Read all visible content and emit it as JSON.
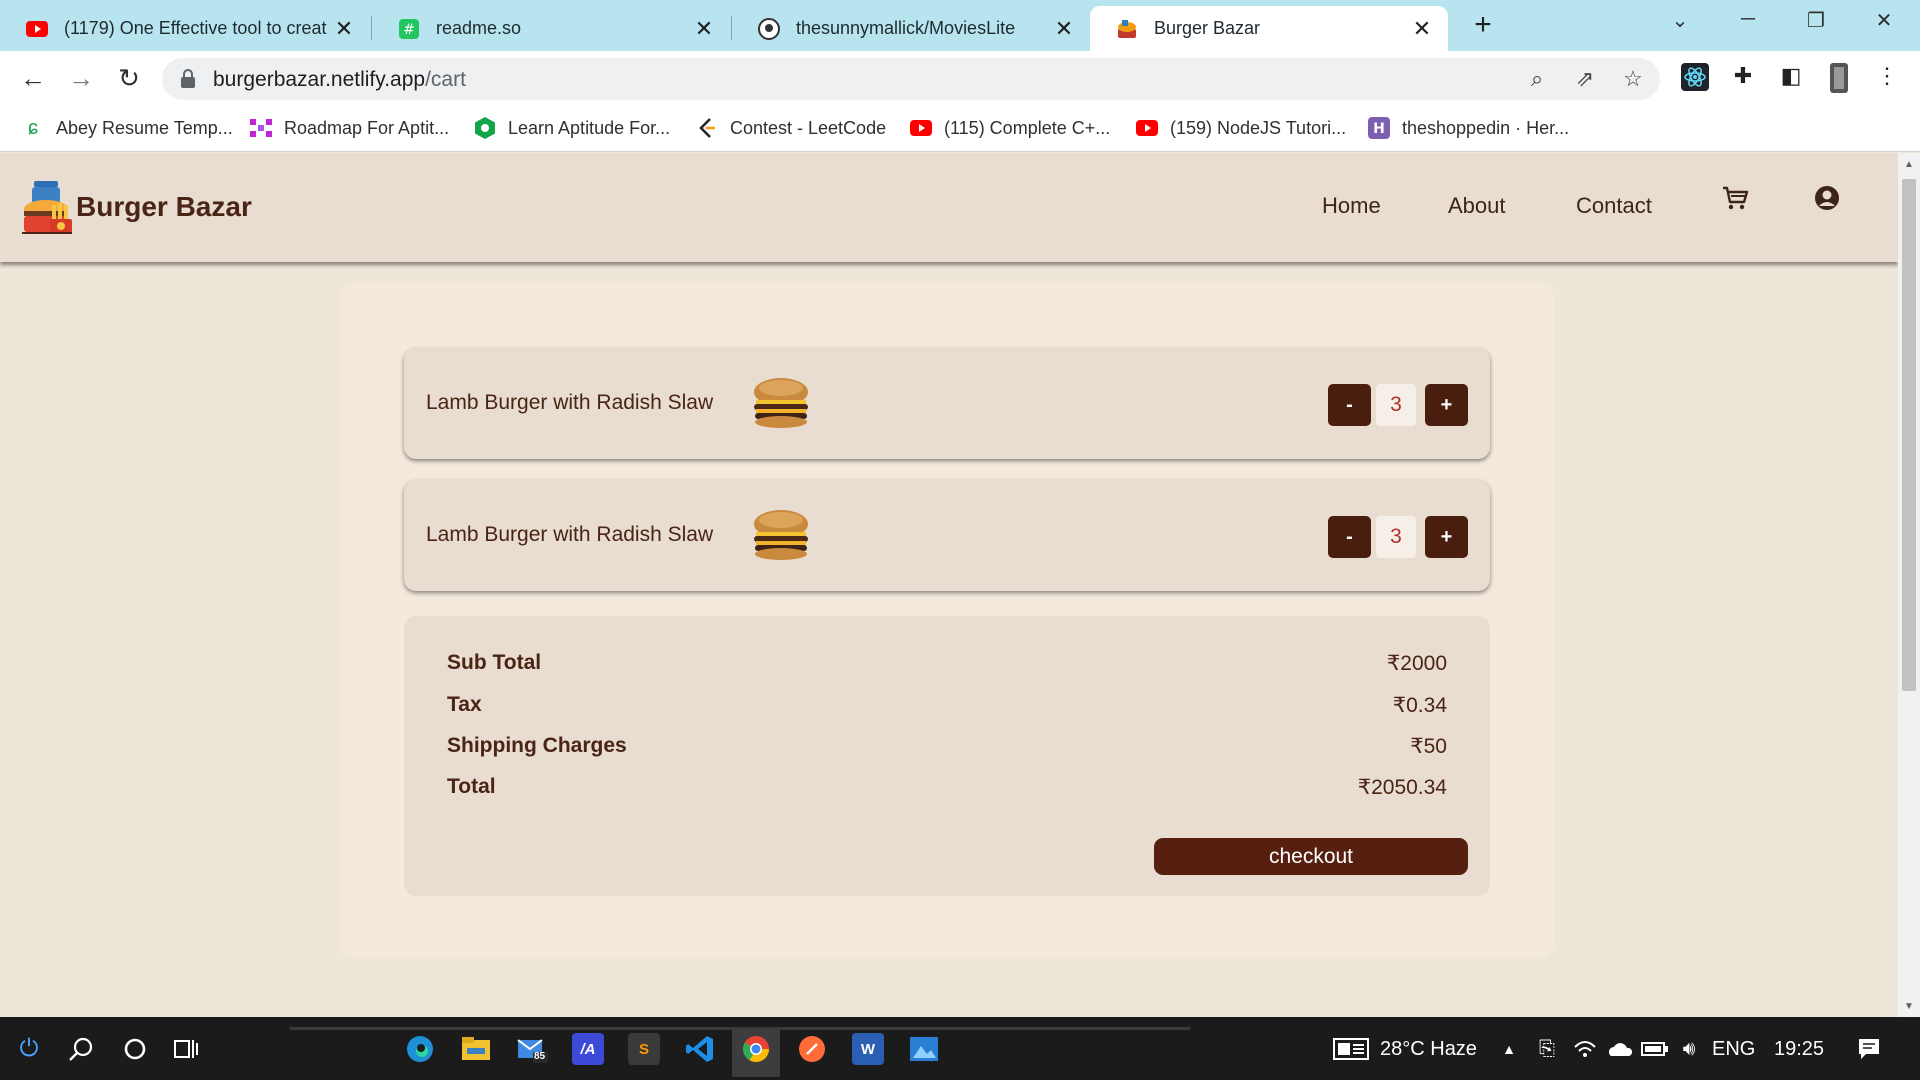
{
  "browser": {
    "tabs": [
      {
        "title": "(1179) One Effective tool to creat",
        "icon": "youtube-icon",
        "active": false
      },
      {
        "title": "readme.so",
        "icon": "readme-icon",
        "active": false
      },
      {
        "title": "thesunnymallick/MoviesLite",
        "icon": "github-icon",
        "active": false
      },
      {
        "title": "Burger Bazar",
        "icon": "burger-bazar-icon",
        "active": true
      }
    ],
    "tab_close_glyph": "✕",
    "new_tab_glyph": "+",
    "url_host": "burgerbazar.netlify.app",
    "url_path": "/cart",
    "bookmarks": [
      {
        "label": "Abey Resume Temp...",
        "icon": "leaf-icon"
      },
      {
        "label": "Roadmap For Aptit...",
        "icon": "roadmap-icon"
      },
      {
        "label": "Learn Aptitude For...",
        "icon": "hexagon-icon"
      },
      {
        "label": "Contest - LeetCode",
        "icon": "leetcode-icon"
      },
      {
        "label": "(115) Complete C+...",
        "icon": "youtube-icon"
      },
      {
        "label": "(159) NodeJS Tutori...",
        "icon": "youtube-icon"
      },
      {
        "label": "theshoppedin · Her...",
        "icon": "heroku-icon"
      }
    ]
  },
  "site": {
    "brand": "Burger Bazar",
    "nav": {
      "home": "Home",
      "about": "About",
      "contact": "Contact"
    },
    "cart": {
      "items": [
        {
          "name": "Lamb Burger with Radish Slaw",
          "quantity": "3",
          "minus": "-",
          "plus": "+"
        },
        {
          "name": "Lamb Burger with Radish Slaw",
          "quantity": "3",
          "minus": "-",
          "plus": "+"
        }
      ],
      "summary": {
        "subtotal_label": "Sub Total",
        "subtotal_value": "₹2000",
        "tax_label": "Tax",
        "tax_value": "₹0.34",
        "shipping_label": "Shipping Charges",
        "shipping_value": "₹50",
        "total_label": "Total",
        "total_value": "₹2050.34"
      },
      "checkout_label": "checkout"
    },
    "colors": {
      "accent": "#571f10",
      "text": "#4a2415",
      "quantity": "#b2312a",
      "background": "#efe6da"
    }
  },
  "taskbar": {
    "weather": "28°C  Haze",
    "language": "ENG",
    "time": "19:25",
    "mail_badge": "85"
  }
}
